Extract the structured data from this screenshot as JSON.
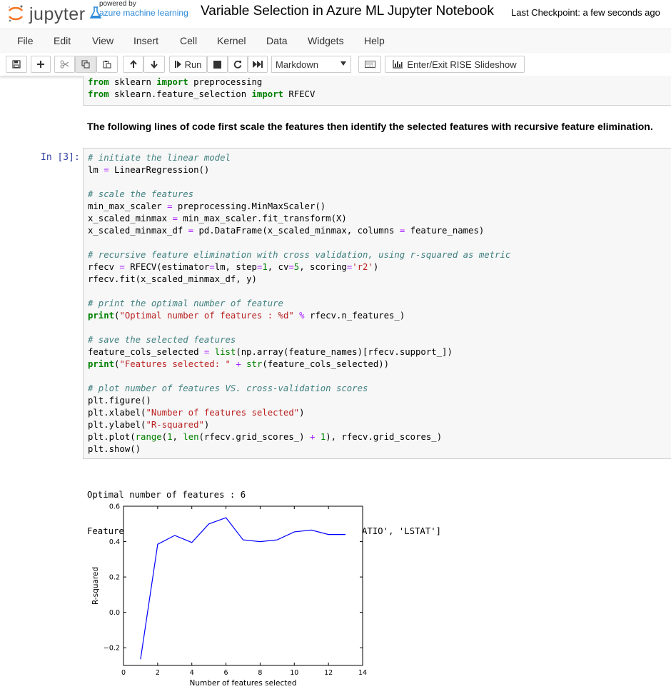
{
  "header": {
    "brand": "jupyter",
    "powered_by": "powered by",
    "azure": "azure machine learning",
    "notebook_title": "Variable Selection in Azure ML Jupyter Notebook",
    "checkpoint": "Last Checkpoint: a few seconds ago"
  },
  "menu": [
    "File",
    "Edit",
    "View",
    "Insert",
    "Cell",
    "Kernel",
    "Data",
    "Widgets",
    "Help"
  ],
  "toolbar": {
    "run_label": "Run",
    "cell_type": "Markdown",
    "rise_label": "Enter/Exit RISE Slideshow"
  },
  "cells": {
    "prev_code": [
      [
        {
          "t": "from",
          "c": "kw"
        },
        {
          "t": " sklearn "
        },
        {
          "t": "import",
          "c": "kw"
        },
        {
          "t": " preprocessing"
        }
      ],
      [
        {
          "t": "from",
          "c": "kw"
        },
        {
          "t": " sklearn.feature_selection "
        },
        {
          "t": "import",
          "c": "kw"
        },
        {
          "t": " RFECV"
        }
      ]
    ],
    "markdown": "The following lines of code first scale the features then identify the selected features with recursive feature elimination.",
    "prompt": "In [3]:",
    "code": [
      [
        {
          "t": "# initiate the linear model",
          "c": "cm"
        }
      ],
      [
        {
          "t": "lm "
        },
        {
          "t": "=",
          "c": "op"
        },
        {
          "t": " LinearRegression()"
        }
      ],
      [],
      [
        {
          "t": "# scale the features",
          "c": "cm"
        }
      ],
      [
        {
          "t": "min_max_scaler "
        },
        {
          "t": "=",
          "c": "op"
        },
        {
          "t": " preprocessing.MinMaxScaler()"
        }
      ],
      [
        {
          "t": "x_scaled_minmax "
        },
        {
          "t": "=",
          "c": "op"
        },
        {
          "t": " min_max_scaler.fit_transform(X)"
        }
      ],
      [
        {
          "t": "x_scaled_minmax_df "
        },
        {
          "t": "=",
          "c": "op"
        },
        {
          "t": " pd.DataFrame(x_scaled_minmax, columns "
        },
        {
          "t": "=",
          "c": "op"
        },
        {
          "t": " feature_names)"
        }
      ],
      [],
      [
        {
          "t": "# recursive feature elimination with cross validation, using r-squared as metric",
          "c": "cm"
        }
      ],
      [
        {
          "t": "rfecv "
        },
        {
          "t": "=",
          "c": "op"
        },
        {
          "t": " RFECV(estimator"
        },
        {
          "t": "=",
          "c": "op"
        },
        {
          "t": "lm, step"
        },
        {
          "t": "=",
          "c": "op"
        },
        {
          "t": "1",
          "c": "nu"
        },
        {
          "t": ", cv"
        },
        {
          "t": "=",
          "c": "op"
        },
        {
          "t": "5",
          "c": "nu"
        },
        {
          "t": ", scoring"
        },
        {
          "t": "=",
          "c": "op"
        },
        {
          "t": "'r2'",
          "c": "st"
        },
        {
          "t": ")"
        }
      ],
      [
        {
          "t": "rfecv.fit(x_scaled_minmax_df, y)"
        }
      ],
      [],
      [
        {
          "t": "# print the optimal number of feature",
          "c": "cm"
        }
      ],
      [
        {
          "t": "print",
          "c": "kw"
        },
        {
          "t": "("
        },
        {
          "t": "\"Optimal number of features : %d\"",
          "c": "st"
        },
        {
          "t": " "
        },
        {
          "t": "%",
          "c": "op"
        },
        {
          "t": " rfecv.n_features_)"
        }
      ],
      [],
      [
        {
          "t": "# save the selected features",
          "c": "cm"
        }
      ],
      [
        {
          "t": "feature_cols_selected "
        },
        {
          "t": "=",
          "c": "op"
        },
        {
          "t": " "
        },
        {
          "t": "list",
          "c": "bi"
        },
        {
          "t": "(np.array(feature_names)[rfecv.support_])"
        }
      ],
      [
        {
          "t": "print",
          "c": "kw"
        },
        {
          "t": "("
        },
        {
          "t": "\"Features selected: \"",
          "c": "st"
        },
        {
          "t": " "
        },
        {
          "t": "+",
          "c": "op"
        },
        {
          "t": " "
        },
        {
          "t": "str",
          "c": "bi"
        },
        {
          "t": "(feature_cols_selected))"
        }
      ],
      [],
      [
        {
          "t": "# plot number of features VS. cross-validation scores",
          "c": "cm"
        }
      ],
      [
        {
          "t": "plt.figure()"
        }
      ],
      [
        {
          "t": "plt.xlabel("
        },
        {
          "t": "\"Number of features selected\"",
          "c": "st"
        },
        {
          "t": ")"
        }
      ],
      [
        {
          "t": "plt.ylabel("
        },
        {
          "t": "\"R-squared\"",
          "c": "st"
        },
        {
          "t": ")"
        }
      ],
      [
        {
          "t": "plt.plot("
        },
        {
          "t": "range",
          "c": "bi"
        },
        {
          "t": "("
        },
        {
          "t": "1",
          "c": "nu"
        },
        {
          "t": ", "
        },
        {
          "t": "len",
          "c": "bi"
        },
        {
          "t": "(rfecv.grid_scores_) "
        },
        {
          "t": "+",
          "c": "op"
        },
        {
          "t": " "
        },
        {
          "t": "1",
          "c": "nu"
        },
        {
          "t": "), rfecv.grid_scores_)"
        }
      ],
      [
        {
          "t": "plt.show()"
        }
      ]
    ],
    "output_lines": [
      "Optimal number of features : 6",
      "Features selected: ['CRIM', 'NOX', 'RM', 'DIS', 'PTRATIO', 'LSTAT']"
    ]
  },
  "chart_data": {
    "type": "line",
    "xlabel": "Number of features selected",
    "ylabel": "R-squared",
    "xlim": [
      0,
      14
    ],
    "ylim": [
      -0.3,
      0.6
    ],
    "xticks": [
      0,
      2,
      4,
      6,
      8,
      10,
      12,
      14
    ],
    "yticks": [
      -0.2,
      0.0,
      0.2,
      0.4,
      0.6
    ],
    "ytick_labels": [
      "−0.2",
      "0.0",
      "0.2",
      "0.4",
      "0.6"
    ],
    "x": [
      1,
      2,
      3,
      4,
      5,
      6,
      7,
      8,
      9,
      10,
      11,
      12,
      13
    ],
    "y": [
      -0.265,
      0.385,
      0.435,
      0.395,
      0.5,
      0.535,
      0.41,
      0.4,
      0.41,
      0.455,
      0.465,
      0.44,
      0.44
    ],
    "color": "#0000ff"
  }
}
